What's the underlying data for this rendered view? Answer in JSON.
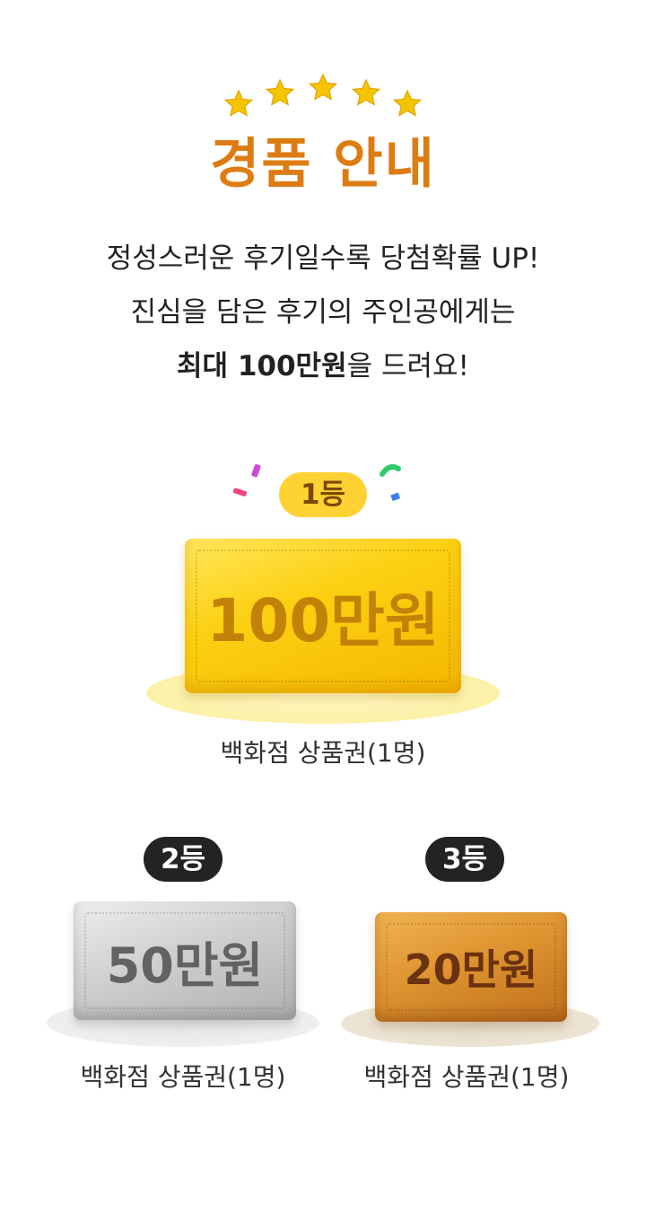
{
  "header": {
    "title": "경품 안내",
    "star_color": "#f5c400"
  },
  "description": {
    "line1": "정성스러운 후기일수록 당첨확률 UP!",
    "line2": "진심을 담은 후기의 주인공에게는",
    "line3_bold": "최대 100만원",
    "line3_rest": "을 드려요!"
  },
  "prizes": [
    {
      "rank": "1등",
      "amount": "100만원",
      "caption": "백화점 상품권(1명)",
      "color": "#fcd012"
    },
    {
      "rank": "2등",
      "amount": "50만원",
      "caption": "백화점 상품권(1명)",
      "color": "#c8c8c8"
    },
    {
      "rank": "3등",
      "amount": "20만원",
      "caption": "백화점 상품권(1명)",
      "color": "#de9430"
    }
  ],
  "colors": {
    "title": "#dd7c12",
    "badge_gold": "#ffd233",
    "badge_dark": "#232323"
  }
}
